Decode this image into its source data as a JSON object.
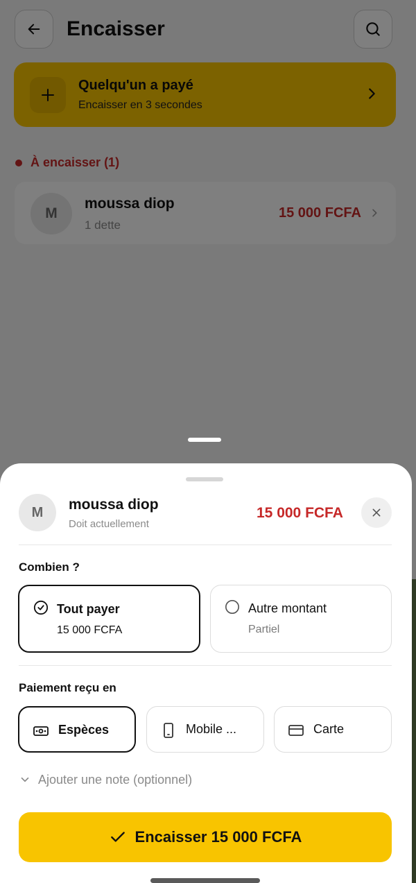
{
  "header": {
    "title": "Encaisser"
  },
  "quick_action": {
    "title": "Quelqu'un a payé",
    "subtitle": "Encaisser en 3 secondes"
  },
  "section": {
    "label": "À encaisser (1)"
  },
  "debtor": {
    "avatar_initial": "M",
    "name": "moussa diop",
    "debt_count": "1 dette",
    "amount": "15 000 FCFA"
  },
  "sheet": {
    "avatar_initial": "M",
    "name": "moussa diop",
    "subtitle": "Doit actuellement",
    "amount": "15 000 FCFA",
    "amount_question": "Combien ?",
    "options": [
      {
        "title": "Tout payer",
        "subtitle": "15 000 FCFA",
        "selected": true
      },
      {
        "title": "Autre montant",
        "subtitle": "Partiel",
        "selected": false
      }
    ],
    "payment_label": "Paiement reçu en",
    "payment_methods": [
      {
        "label": "Espèces",
        "icon": "cash-icon",
        "selected": true
      },
      {
        "label": "Mobile ...",
        "icon": "phone-icon",
        "selected": false
      },
      {
        "label": "Carte",
        "icon": "credit-card-icon",
        "selected": false
      }
    ],
    "note_label": "Ajouter une note (optionnel)",
    "submit_label": "Encaisser 15 000 FCFA"
  },
  "colors": {
    "accent": "#f8c400",
    "danger": "#c62828",
    "text": "#111111",
    "muted": "#8a8a8a"
  }
}
